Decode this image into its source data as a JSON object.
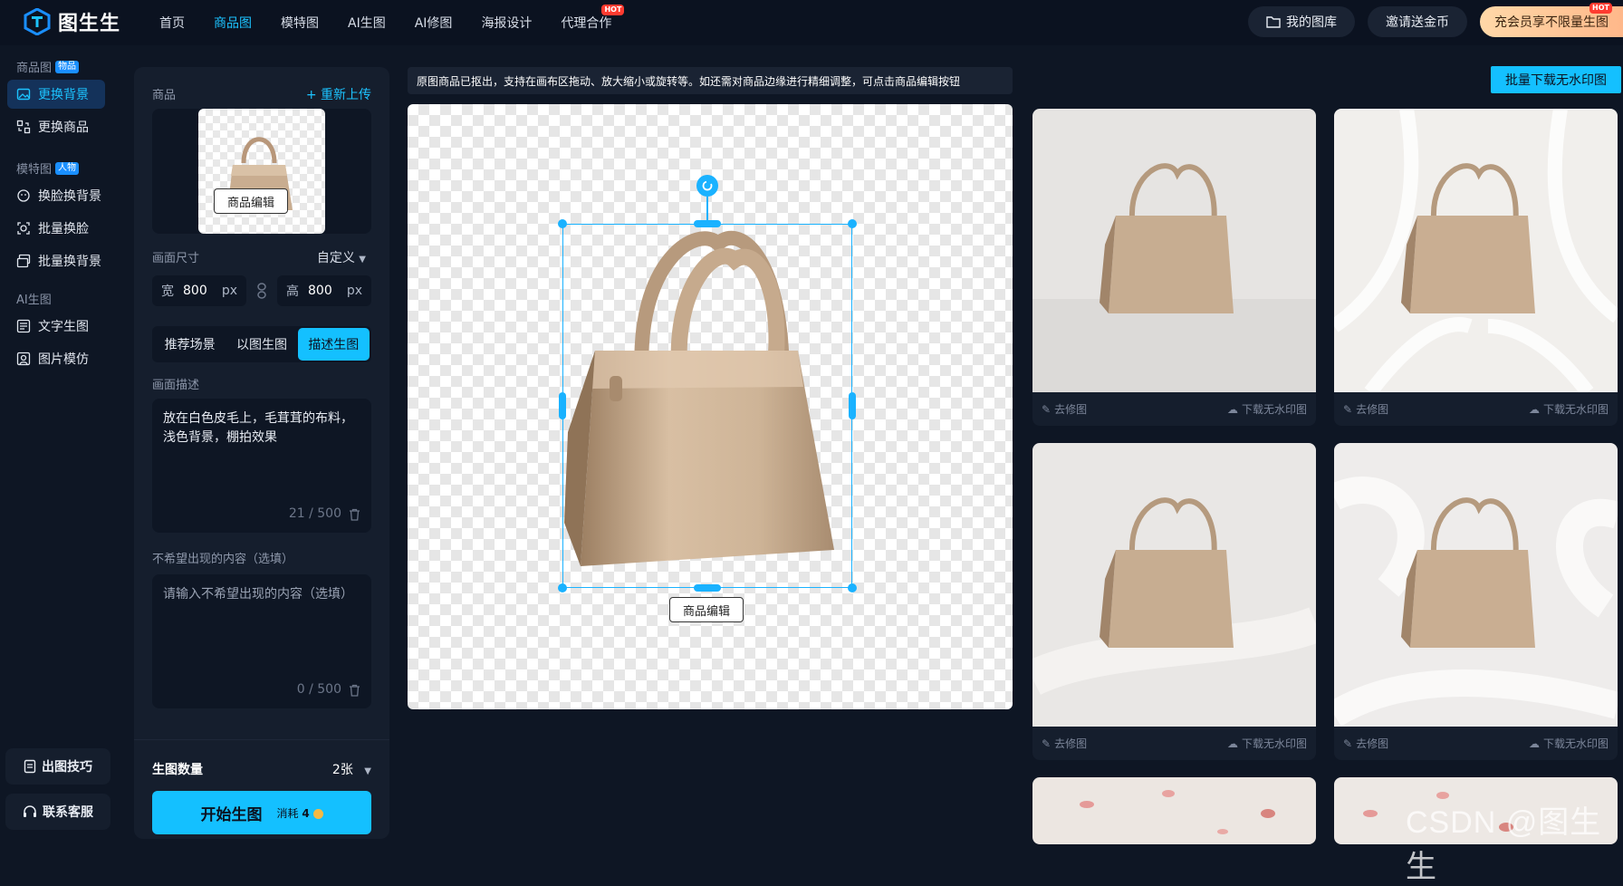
{
  "brand": {
    "name": "图生生"
  },
  "nav": {
    "items": [
      {
        "label": "首页",
        "active": false,
        "hot": false
      },
      {
        "label": "商品图",
        "active": true,
        "hot": false
      },
      {
        "label": "模特图",
        "active": false,
        "hot": false
      },
      {
        "label": "AI生图",
        "active": false,
        "hot": false
      },
      {
        "label": "AI修图",
        "active": false,
        "hot": false
      },
      {
        "label": "海报设计",
        "active": false,
        "hot": false
      },
      {
        "label": "代理合作",
        "active": false,
        "hot": true
      }
    ],
    "hot_badge": "HOT"
  },
  "header": {
    "library_label": "我的图库",
    "invite_label": "邀请送金币",
    "vip_label": "充会员享不限量生图",
    "vip_hot": "HOT"
  },
  "sidebar": {
    "sections": [
      {
        "title": "商品图",
        "tag": "物品"
      },
      {
        "title": "模特图",
        "tag": "人物"
      },
      {
        "title": "AI生图",
        "tag": ""
      }
    ],
    "items": [
      {
        "label": "更换背景",
        "active": true
      },
      {
        "label": "更换商品",
        "active": false
      },
      {
        "label": "换脸换背景",
        "active": false
      },
      {
        "label": "批量换脸",
        "active": false
      },
      {
        "label": "批量换背景",
        "active": false
      },
      {
        "label": "文字生图",
        "active": false
      },
      {
        "label": "图片模仿",
        "active": false
      }
    ],
    "bottom": [
      {
        "label": "出图技巧"
      },
      {
        "label": "联系客服"
      }
    ]
  },
  "panel": {
    "product_label": "商品",
    "reupload_label": "+ 重新上传",
    "thumb_edit_label": "商品编辑",
    "size_label": "画面尺寸",
    "size_mode": "自定义",
    "width_label": "宽",
    "width_value": "800",
    "height_label": "高",
    "height_value": "800",
    "unit": "px",
    "tabs": [
      {
        "label": "推荐场景",
        "active": false
      },
      {
        "label": "以图生图",
        "active": false
      },
      {
        "label": "描述生图",
        "active": true
      }
    ],
    "desc_label": "画面描述",
    "desc_text": "放在白色皮毛上，毛茸茸的布料，浅色背景，棚拍效果",
    "desc_count": "21 / 500",
    "neg_label": "不希望出现的内容（选填）",
    "neg_placeholder": "请输入不希望出现的内容（选填）",
    "neg_count": "0 / 500",
    "qty_label": "生图数量",
    "qty_value": "2张",
    "generate_label": "开始生图",
    "cost_label": "消耗",
    "cost_value": "4"
  },
  "canvas": {
    "notice": "原图商品已抠出，支持在画布区拖动、放大缩小或旋转等。如还需对商品边缘进行精细调整，可点击商品编辑按钮",
    "edit_label": "商品编辑"
  },
  "results": {
    "batch_download_label": "批量下载无水印图",
    "retouch_label": "去修图",
    "download_label": "下载无水印图",
    "items": [
      {
        "bg": "#e6e4e2"
      },
      {
        "bg": "#f1efec"
      },
      {
        "bg": "#e9e7e5"
      },
      {
        "bg": "#eeeceb"
      }
    ]
  },
  "watermark": "CSDN @图生生"
}
